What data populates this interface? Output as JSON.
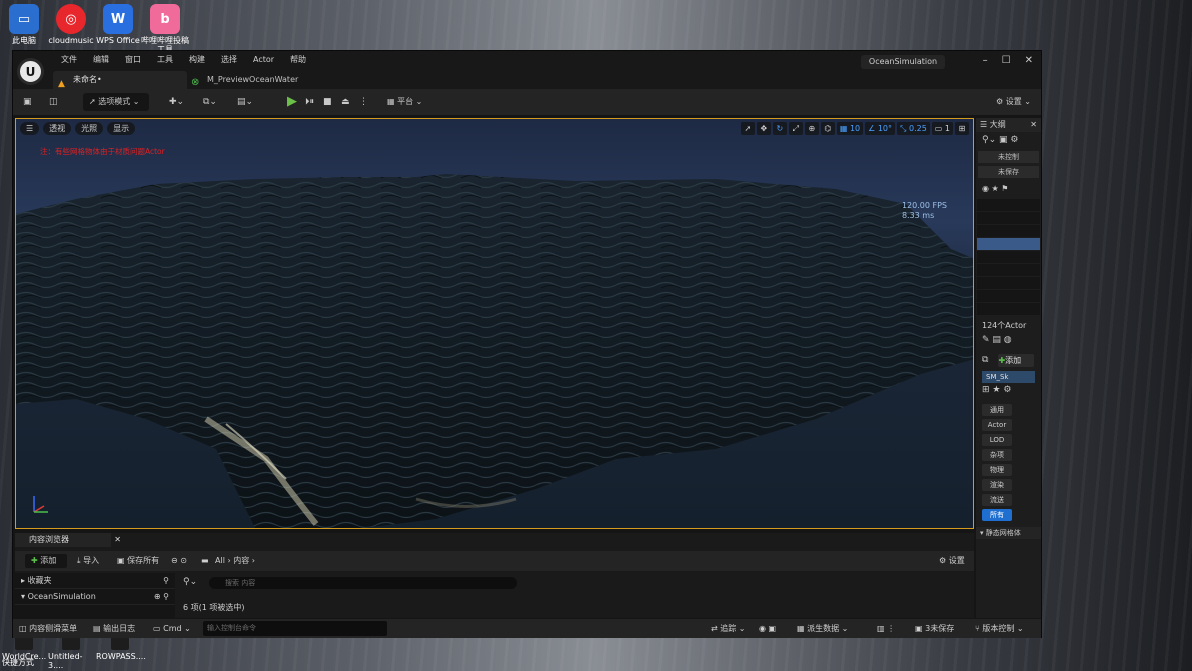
{
  "desktop": {
    "icons": [
      "此电脑",
      "cloudmusic",
      "WPS Office",
      "哔哩哔哩投稿工具"
    ],
    "taskbar": [
      "WorldCre...",
      "Untitled-3....",
      "ROWPASS....",
      "快捷方式"
    ]
  },
  "window": {
    "menu": [
      "文件",
      "编辑",
      "窗口",
      "工具",
      "构建",
      "选择",
      "Actor",
      "帮助"
    ],
    "project_title": "OceanSimulation",
    "tabs": [
      {
        "label": "未命名•"
      },
      {
        "label": "M_PreviewOceanWater"
      }
    ],
    "win_buttons": [
      "–",
      "☐",
      "✕"
    ]
  },
  "toolbar": {
    "mode_label": "选项模式",
    "platform_label": "平台",
    "settings_label": "设置"
  },
  "viewport": {
    "buttons": [
      "透视",
      "光照",
      "显示"
    ],
    "warning": "注：有些网格物体由于材质问题Actor",
    "grid_value": "10",
    "angle_value": "10°",
    "scale_value": "0.25",
    "camera_value": "1",
    "fps": "120.00 FPS",
    "ms": "8.33 ms"
  },
  "outliner": {
    "title": "大纲",
    "tags": [
      "未控制",
      "未保存"
    ],
    "actor_count": "124个Actor",
    "add_label": "添加",
    "component": "SM_Sk",
    "categories": [
      "通用",
      "Actor",
      "LOD",
      "杂项",
      "物理",
      "渲染",
      "流送",
      "所有"
    ],
    "section": "静态网格体"
  },
  "content_browser": {
    "tab_label": "内容浏览器",
    "add_label": "添加",
    "import_label": "导入",
    "save_all_label": "保存所有",
    "path_all": "All",
    "path_content": "内容",
    "settings_label": "设置",
    "favorites_label": "收藏夹",
    "project_label": "OceanSimulation",
    "search_placeholder": "搜索 内容",
    "items_count": "6 项(1 项被选中)"
  },
  "statusbar": {
    "drawer": "内容侧滑菜单",
    "output_log": "输出日志",
    "cmd": "Cmd",
    "cmd_placeholder": "输入控制台命令",
    "trace": "追踪",
    "derived_data": "派生数据",
    "unsaved": "3未保存",
    "version_control": "版本控制"
  }
}
